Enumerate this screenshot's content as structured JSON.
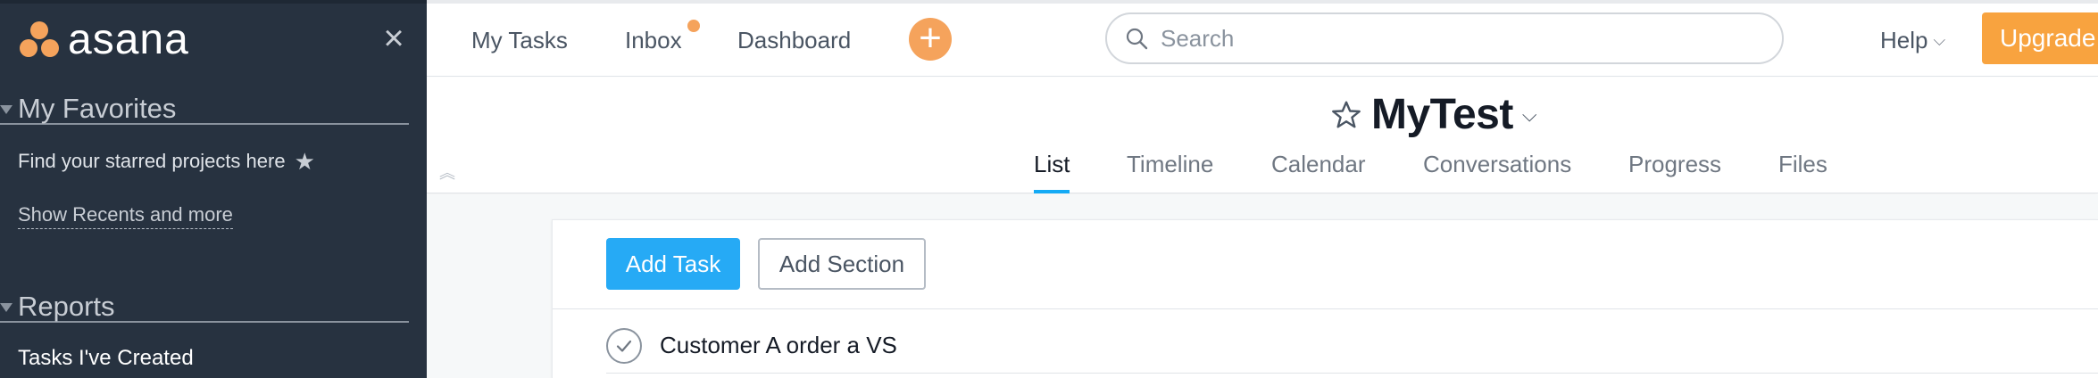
{
  "sidebar": {
    "logo_text": "asana",
    "favorites": {
      "title": "My Favorites",
      "hint": "Find your starred projects here",
      "show_recents": "Show Recents and more"
    },
    "reports": {
      "title": "Reports",
      "items": [
        "Tasks I've Created"
      ]
    }
  },
  "topbar": {
    "nav": [
      "My Tasks",
      "Inbox",
      "Dashboard"
    ],
    "inbox_has_notification": true,
    "search_placeholder": "Search",
    "help_label": "Help",
    "upgrade_label": "Upgrade"
  },
  "project": {
    "name": "MyTest",
    "tabs": [
      "List",
      "Timeline",
      "Calendar",
      "Conversations",
      "Progress",
      "Files"
    ],
    "active_tab": "List"
  },
  "list": {
    "add_task_label": "Add Task",
    "add_section_label": "Add Section",
    "tasks": [
      {
        "name": "Customer A order a VS",
        "completed": false
      }
    ]
  },
  "colors": {
    "sidebar_bg": "#273240",
    "accent_orange": "#f5a35c",
    "upgrade_orange": "#f8a33f",
    "primary_blue": "#26aaf5",
    "tab_underline": "#14aaf5"
  }
}
